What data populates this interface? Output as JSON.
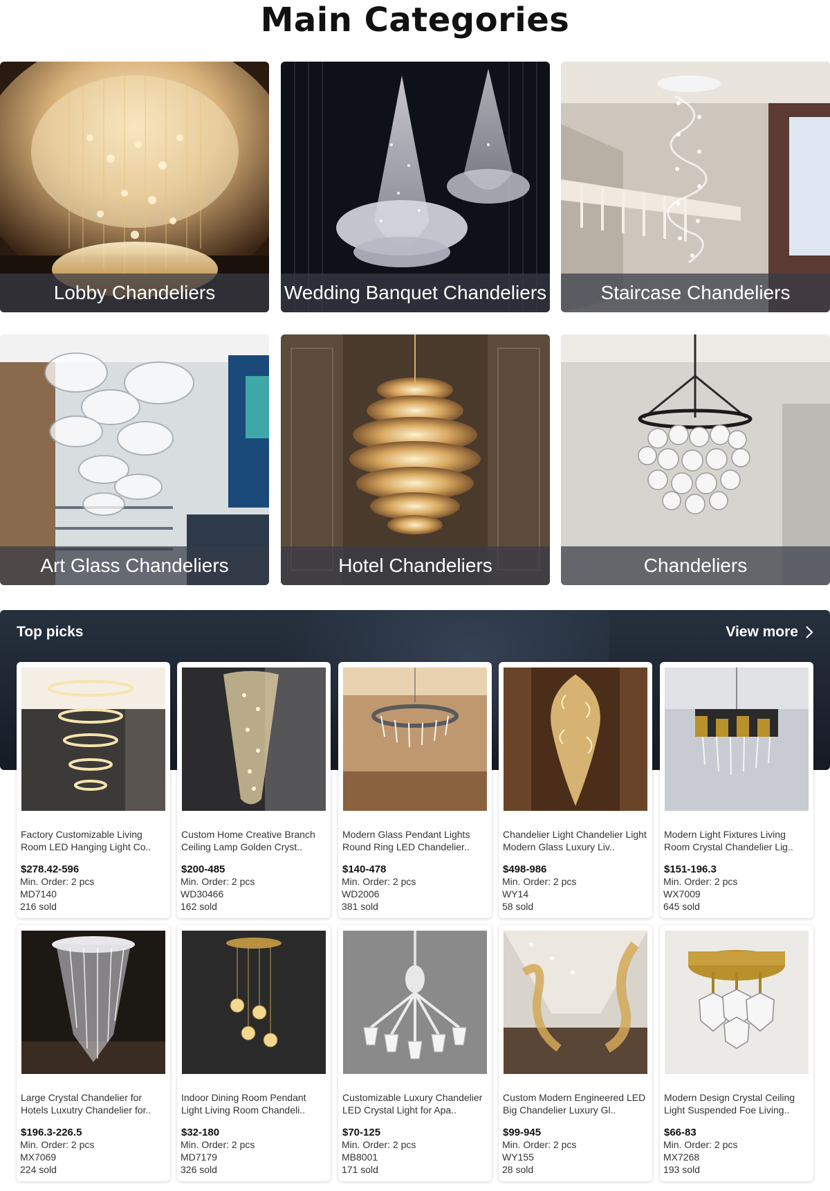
{
  "page_title": "Main Categories",
  "categories": [
    {
      "label": "Lobby Chandeliers"
    },
    {
      "label": "Wedding Banquet Chandeliers"
    },
    {
      "label": "Staircase Chandeliers"
    },
    {
      "label": "Art Glass Chandeliers"
    },
    {
      "label": "Hotel Chandeliers"
    },
    {
      "label": "Chandeliers"
    }
  ],
  "top_picks": {
    "title": "Top picks",
    "view_more": "View more",
    "products": [
      {
        "name": "Factory Customizable Living Room LED Hanging Light Co..",
        "price": "$278.42-596",
        "min_order": "Min. Order: 2 pcs",
        "code": "MD7140",
        "sold": "216 sold"
      },
      {
        "name": "Custom Home Creative Branch Ceiling Lamp Golden Cryst..",
        "price": "$200-485",
        "min_order": "Min. Order: 2 pcs",
        "code": "WD30466",
        "sold": "162 sold"
      },
      {
        "name": "Modern Glass Pendant Lights Round Ring LED Chandelier..",
        "price": "$140-478",
        "min_order": "Min. Order: 2 pcs",
        "code": "WD2006",
        "sold": "381 sold"
      },
      {
        "name": "Chandelier Light Chandelier Light Modern Glass Luxury Liv..",
        "price": "$498-986",
        "min_order": "Min. Order: 2 pcs",
        "code": "WY14",
        "sold": "58 sold"
      },
      {
        "name": "Modern Light Fixtures Living Room Crystal Chandelier Lig..",
        "price": "$151-196.3",
        "min_order": "Min. Order: 2 pcs",
        "code": "WX7009",
        "sold": "645 sold"
      },
      {
        "name": "Large Crystal Chandelier for Hotels Luxutry Chandelier for..",
        "price": "$196.3-226.5",
        "min_order": "Min. Order: 2 pcs",
        "code": "MX7069",
        "sold": "224 sold"
      },
      {
        "name": "Indoor Dining Room Pendant Light Living Room Chandeli..",
        "price": "$32-180",
        "min_order": "Min. Order: 2 pcs",
        "code": "MD7179",
        "sold": "326 sold"
      },
      {
        "name": "Customizable Luxury Chandelier LED Crystal Light for Apa..",
        "price": "$70-125",
        "min_order": "Min. Order: 2 pcs",
        "code": "MB8001",
        "sold": "171 sold"
      },
      {
        "name": "Custom Modern Engineered LED Big Chandelier Luxury Gl..",
        "price": "$99-945",
        "min_order": "Min. Order: 2 pcs",
        "code": "WY155",
        "sold": "28 sold"
      },
      {
        "name": "Modern Design Crystal Ceiling Light Suspended Foe Living..",
        "price": "$66-83",
        "min_order": "Min. Order: 2 pcs",
        "code": "MX7268",
        "sold": "193 sold"
      }
    ]
  },
  "icons": {
    "view_more": "chevron-right-icon"
  }
}
